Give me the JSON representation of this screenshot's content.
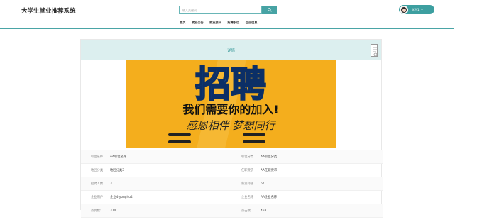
{
  "header": {
    "site_title": "大学生就业推荐系统",
    "search_placeholder": "输入关键词",
    "nav": [
      "首页",
      "就业公告",
      "就业资讯",
      "招聘职位",
      "企业信息"
    ],
    "user_name": "学生1",
    "user_caret": "▾"
  },
  "detail": {
    "title": "详情",
    "poster_text": {
      "big": "招聘",
      "line1": "我们需要你的加入!",
      "line2": "感恩相伴 梦想同行"
    },
    "rows": [
      [
        {
          "label": "职位名称",
          "value": "AA职位名称"
        },
        {
          "label": "职位分类",
          "value": "AA职位分类"
        }
      ],
      [
        {
          "label": "地区分类",
          "value": "地区分类3"
        },
        {
          "label": "任职要求",
          "value": "AA任职要求"
        }
      ],
      [
        {
          "label": "招聘人数",
          "value": "3"
        },
        {
          "label": "薪资待遇",
          "value": "6K"
        }
      ],
      [
        {
          "label": "企业用户",
          "value": "企业4-yonghu4"
        },
        {
          "label": "企业名称",
          "value": "AA企业名称"
        }
      ],
      [
        {
          "label": "点赞数:",
          "value": "374"
        },
        {
          "label": "点击数:",
          "value": "458"
        }
      ]
    ]
  },
  "colors": {
    "accent": "#47a3a4",
    "header_bg": "#dcefef",
    "poster_bg": "#f4ae1d"
  }
}
